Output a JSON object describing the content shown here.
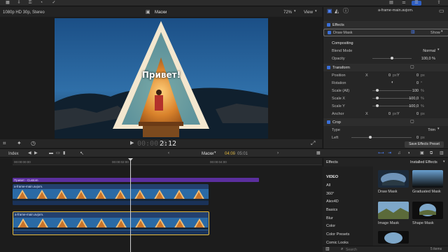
{
  "viewer": {
    "format": "1080p HD 30p, Stereo",
    "project_name": "Маски",
    "zoom": "72%",
    "view_label": "View",
    "overlay_text": "Привет!",
    "timecode_dim": "00:00:0",
    "timecode_main": "2:12"
  },
  "inspector": {
    "clip_name": "a-frame-main.avjom.",
    "effects_label": "Effects",
    "draw_mask_label": "Draw Mask",
    "draw_mask_show": "Show",
    "compositing_label": "Compositing",
    "blend_mode_label": "Blend Mode",
    "blend_mode_value": "Normal",
    "opacity_label": "Opacity",
    "opacity_value": "100,0 %",
    "transform_label": "Transform",
    "position_label": "Position",
    "x_label": "X",
    "y_label": "Y",
    "pos_x": "0",
    "pos_y": "0",
    "px": "px",
    "rotation_label": "Rotation",
    "rotation_value": "0",
    "deg": "°",
    "scale_all_label": "Scale (All)",
    "scale_all_value": "100",
    "pct": "%",
    "scale_x_label": "Scale X",
    "scale_x_value": "100,0",
    "scale_y_label": "Scale Y",
    "scale_y_value": "100,0",
    "anchor_label": "Anchor",
    "anchor_x": "0",
    "anchor_y": "0",
    "crop_label": "Crop",
    "type_label": "Type",
    "type_value": "Trim",
    "left_label": "Left",
    "left_value": "0",
    "save_preset": "Save Effects Preset"
  },
  "timeline": {
    "index_label": "Index",
    "project_name": "Маски",
    "duration_current": "04:00",
    "duration_total": "05:01",
    "ruler_ticks": [
      "00:00:00:00",
      "00:00:02:00",
      "00:00:04:00"
    ],
    "title_clip": "Привет - Custom",
    "clip_upper": "a-frame-main.avjom.",
    "clip_lower": "a-frame-main.avjom."
  },
  "effects_browser": {
    "header_left": "Effects",
    "header_right": "Installed Effects",
    "categories": [
      "VIDEO",
      "All",
      "360°",
      "Alex4D",
      "Basics",
      "Blur",
      "Color",
      "Color Presets",
      "Comic Looks"
    ],
    "effects": [
      "Draw Mask",
      "Graduated Mask",
      "Image Mask",
      "Shape Mask"
    ],
    "search_placeholder": "Search",
    "items_count": "5 items"
  },
  "colors": {
    "accent": "#3a6fd8",
    "title_clip": "#5b2f9e",
    "clip_selected_border": "#e4b93a",
    "playhead": "#cfcfcf"
  }
}
